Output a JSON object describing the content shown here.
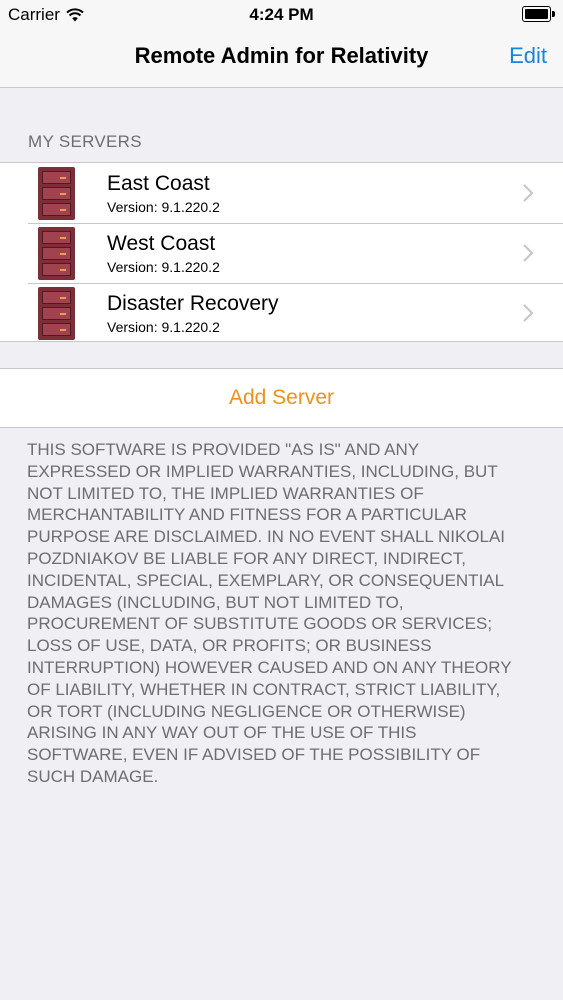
{
  "status_bar": {
    "carrier": "Carrier",
    "time": "4:24 PM",
    "icons": [
      "wifi-icon",
      "battery-icon"
    ]
  },
  "nav": {
    "title": "Remote Admin for Relativity",
    "edit_label": "Edit"
  },
  "section_header": "MY SERVERS",
  "servers": [
    {
      "name": "East Coast",
      "version": "Version: 9.1.220.2",
      "icon": "server-icon"
    },
    {
      "name": "West Coast",
      "version": "Version: 9.1.220.2",
      "icon": "server-icon"
    },
    {
      "name": "Disaster Recovery",
      "version": "Version: 9.1.220.2",
      "icon": "server-icon"
    }
  ],
  "add_server_label": "Add Server",
  "license_text": "THIS SOFTWARE IS PROVIDED \"AS IS\" AND ANY\nEXPRESSED OR IMPLIED WARRANTIES, INCLUDING, BUT\nNOT LIMITED TO, THE IMPLIED WARRANTIES OF\nMERCHANTABILITY AND FITNESS FOR A PARTICULAR\nPURPOSE ARE DISCLAIMED. IN NO EVENT SHALL NIKOLAI\nPOZDNIAKOV BE LIABLE FOR ANY DIRECT, INDIRECT,\nINCIDENTAL, SPECIAL, EXEMPLARY, OR CONSEQUENTIAL\nDAMAGES (INCLUDING, BUT NOT LIMITED TO,\nPROCUREMENT OF SUBSTITUTE GOODS OR SERVICES;\nLOSS OF USE, DATA, OR PROFITS; OR BUSINESS\nINTERRUPTION) HOWEVER CAUSED AND ON ANY THEORY\nOF LIABILITY, WHETHER IN CONTRACT, STRICT LIABILITY,\nOR TORT (INCLUDING NEGLIGENCE OR OTHERWISE)\nARISING IN ANY WAY OUT OF THE USE OF THIS\nSOFTWARE, EVEN IF ADVISED OF THE POSSIBILITY OF\nSUCH DAMAGE.",
  "colors": {
    "accent_blue": "#1a82e2",
    "accent_orange": "#f0901e",
    "server_icon": "#7d2e36",
    "background": "#efeff4"
  }
}
